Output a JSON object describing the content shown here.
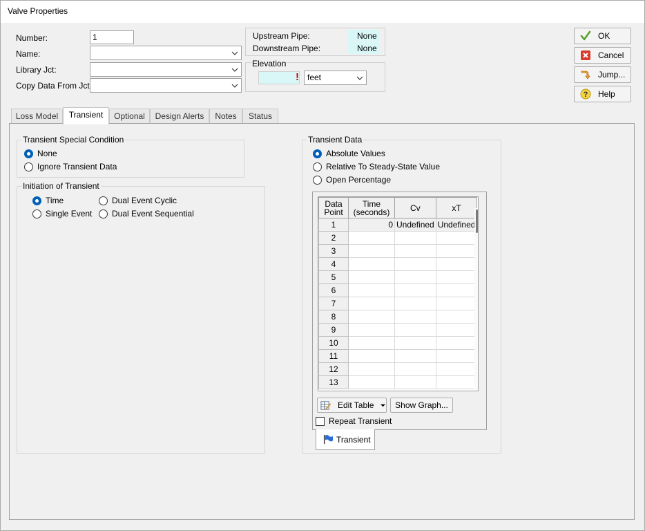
{
  "window": {
    "title": "Valve Properties"
  },
  "form": {
    "number_label": "Number:",
    "number_value": "1",
    "name_label": "Name:",
    "name_value": "",
    "library_label": "Library Jct:",
    "library_value": "",
    "copy_label": "Copy Data From Jct...",
    "copy_value": ""
  },
  "pipes": {
    "upstream_label": "Upstream Pipe:",
    "upstream_value": "None",
    "downstream_label": "Downstream Pipe:",
    "downstream_value": "None"
  },
  "elevation": {
    "title": "Elevation",
    "value": "",
    "unit": "feet",
    "required_mark": "!"
  },
  "buttons": {
    "ok": "OK",
    "cancel": "Cancel",
    "jump": "Jump...",
    "help": "Help"
  },
  "tabs": [
    {
      "label": "Loss Model"
    },
    {
      "label": "Transient"
    },
    {
      "label": "Optional"
    },
    {
      "label": "Design Alerts"
    },
    {
      "label": "Notes"
    },
    {
      "label": "Status"
    }
  ],
  "transient_special": {
    "title": "Transient Special Condition",
    "options": [
      "None",
      "Ignore Transient Data"
    ],
    "selected": "None"
  },
  "initiation": {
    "title": "Initiation of Transient",
    "options": [
      "Time",
      "Single Event",
      "Dual Event Cyclic",
      "Dual Event Sequential"
    ],
    "selected": "Time"
  },
  "transient_data": {
    "title": "Transient Data",
    "options": [
      "Absolute Values",
      "Relative To Steady-State Value",
      "Open Percentage"
    ],
    "selected": "Absolute Values",
    "table": {
      "headers": [
        "Data Point",
        "Time (seconds)",
        "Cv",
        "xT"
      ],
      "header_lines": [
        [
          "Data",
          "Point"
        ],
        [
          "Time",
          "(seconds)"
        ],
        [
          "Cv"
        ],
        [
          "xT"
        ]
      ],
      "rows": [
        [
          "1",
          "0",
          "Undefined",
          "Undefined"
        ],
        [
          "2",
          "",
          "",
          ""
        ],
        [
          "3",
          "",
          "",
          ""
        ],
        [
          "4",
          "",
          "",
          ""
        ],
        [
          "5",
          "",
          "",
          ""
        ],
        [
          "6",
          "",
          "",
          ""
        ],
        [
          "7",
          "",
          "",
          ""
        ],
        [
          "8",
          "",
          "",
          ""
        ],
        [
          "9",
          "",
          "",
          ""
        ],
        [
          "10",
          "",
          "",
          ""
        ],
        [
          "11",
          "",
          "",
          ""
        ],
        [
          "12",
          "",
          "",
          ""
        ],
        [
          "13",
          "",
          "",
          ""
        ]
      ]
    },
    "edit_table_label": "Edit Table",
    "show_graph_label": "Show Graph...",
    "repeat_label": "Repeat Transient",
    "repeat_checked": false,
    "bottom_tab_label": "Transient"
  },
  "colors": {
    "accent": "#005fb8",
    "required": "#cc0000",
    "cyan_field": "#d9f7f7"
  }
}
